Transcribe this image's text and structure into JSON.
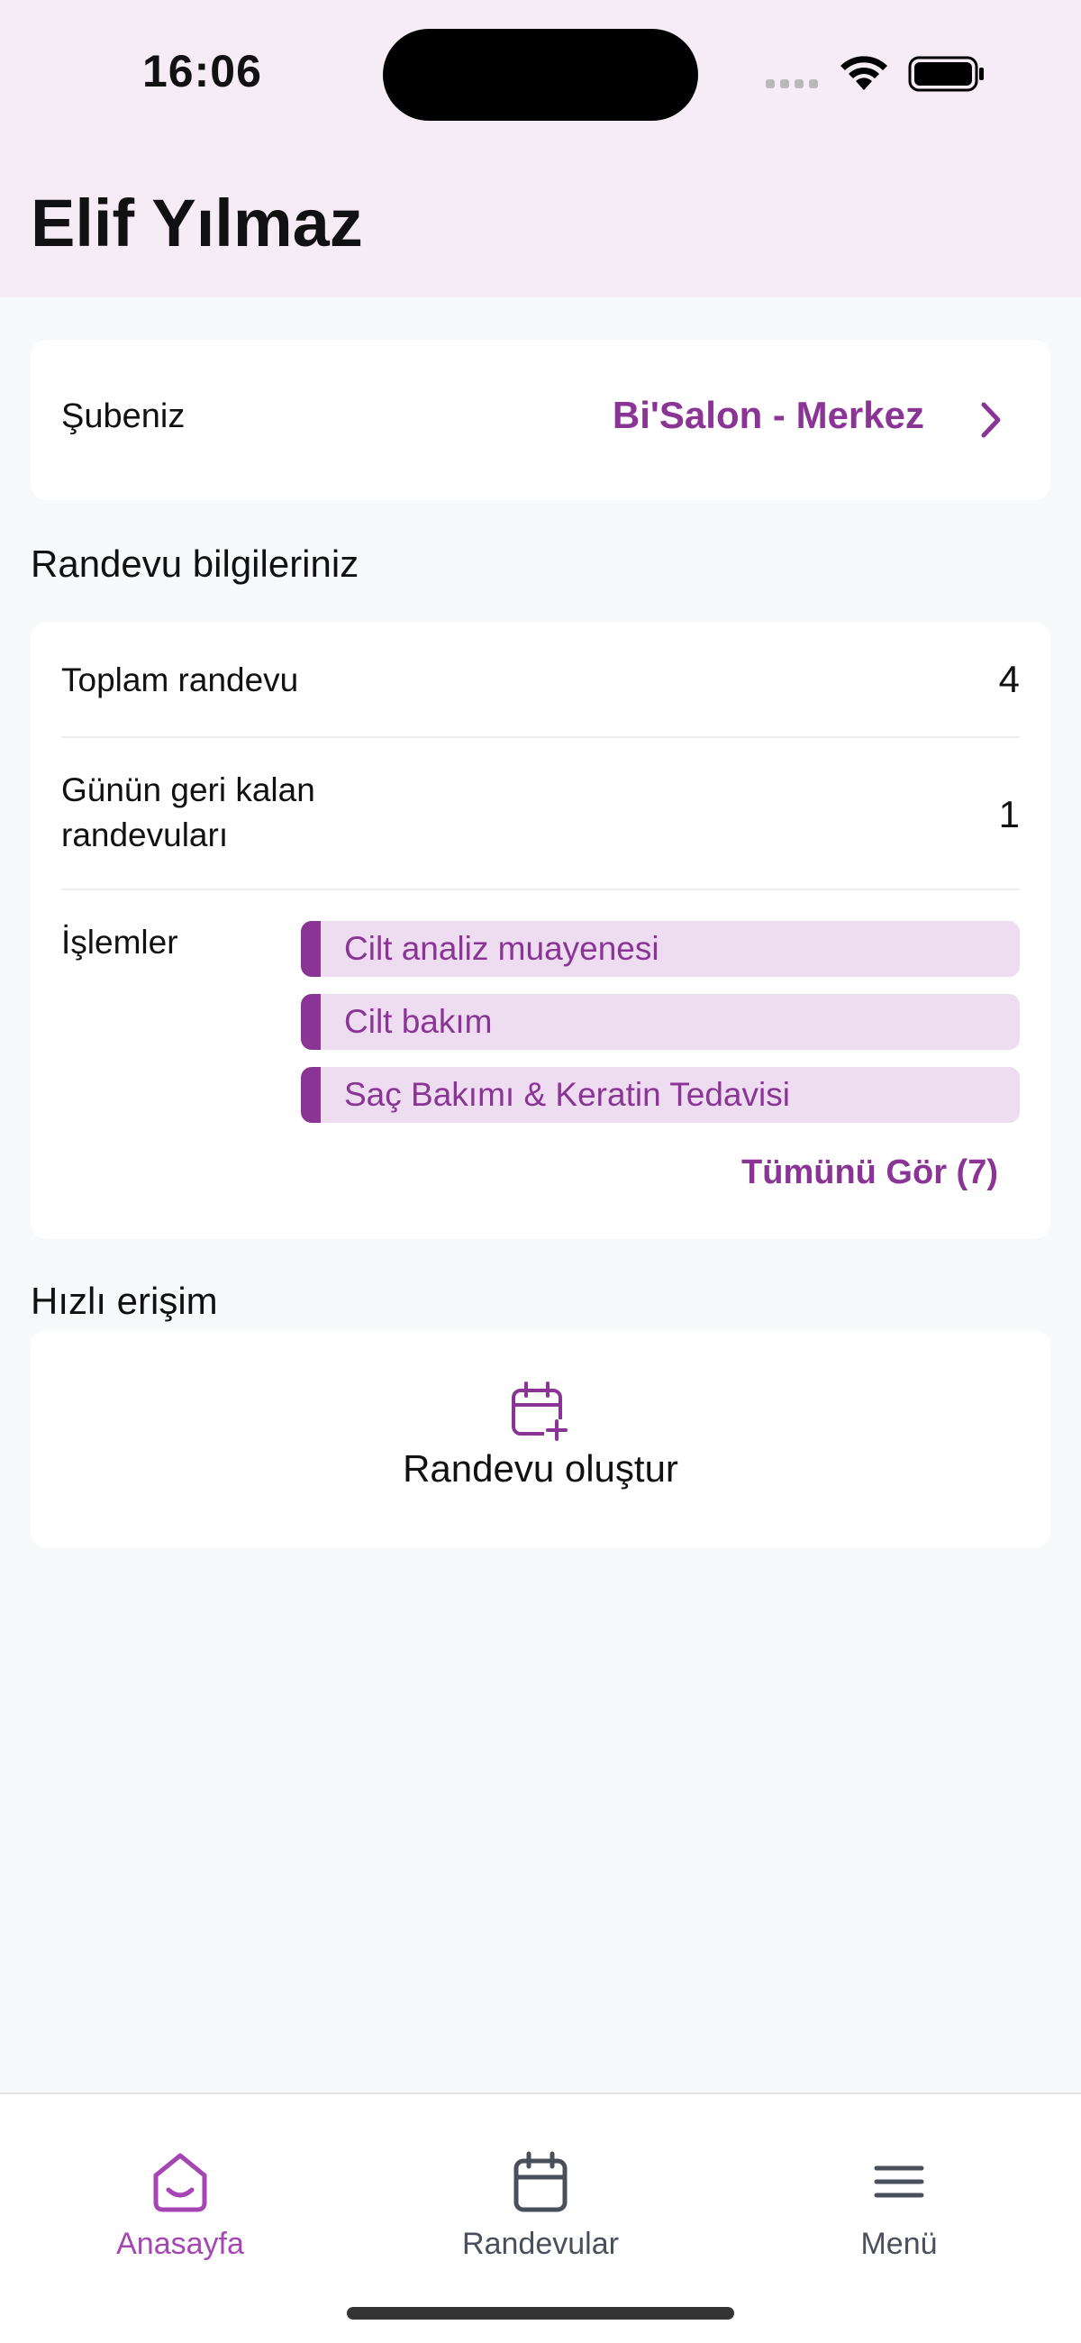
{
  "status": {
    "time": "16:06"
  },
  "header": {
    "user_name": "Elif Yılmaz"
  },
  "branch": {
    "label": "Şubeniz",
    "value": "Bi'Salon - Merkez"
  },
  "appointments": {
    "section_title": "Randevu bilgileriniz",
    "total_label": "Toplam randevu",
    "total_value": "4",
    "remaining_label_line1": "Günün geri kalan",
    "remaining_label_line2": "randevuları",
    "remaining_value": "1",
    "operations_label": "İşlemler",
    "operations": [
      "Cilt analiz muayenesi",
      "Cilt bakım",
      "Saç Bakımı & Keratin Tedavisi"
    ],
    "see_all": "Tümünü Gör (7)"
  },
  "quick_access": {
    "section_title": "Hızlı erişim",
    "create_label": "Randevu oluştur",
    "icon": "calendar-plus-icon"
  },
  "tabbar": {
    "home_label": "Anasayfa",
    "appointments_label": "Randevular",
    "menu_label": "Menü",
    "active_color": "#a646b4"
  },
  "colors": {
    "accent": "#8a3596",
    "header_bg": "#f6ecf5",
    "pill_bg": "#eedcf0"
  }
}
